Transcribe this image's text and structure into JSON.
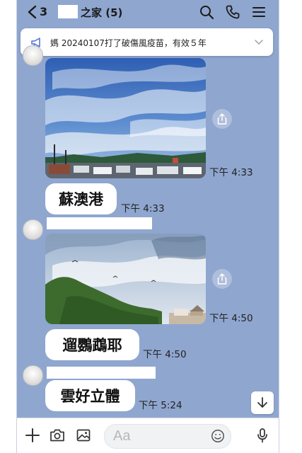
{
  "header": {
    "back_count": "3",
    "title": "之家 (5)"
  },
  "announcement": {
    "text": "媽 20240107打了破傷風疫苗，有效５年"
  },
  "messages": [
    {
      "type": "photo",
      "time": "下午 4:33"
    },
    {
      "type": "text",
      "text": "蘇澳港",
      "time": "下午 4:33"
    },
    {
      "type": "photo",
      "time": "下午 4:50"
    },
    {
      "type": "text",
      "text": "遛鸚鵡耶",
      "time": "下午 4:50"
    },
    {
      "type": "text",
      "text": "雲好立體",
      "time": "下午 5:24"
    }
  ],
  "input": {
    "placeholder": "Aa"
  },
  "colors": {
    "chat_background": "#8fa6cf",
    "bubble": "#ffffff",
    "input_background": "#f1f2f4"
  }
}
